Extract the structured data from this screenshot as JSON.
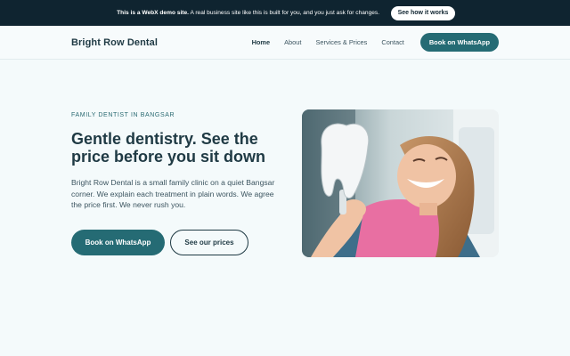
{
  "banner": {
    "bold": "This is a WebX demo site.",
    "text": " A real business site like this is built for you, and you just ask for changes.",
    "button": "See how it works"
  },
  "header": {
    "logo": "Bright Row Dental",
    "nav": [
      {
        "label": "Home",
        "active": true
      },
      {
        "label": "About"
      },
      {
        "label": "Services & Prices"
      },
      {
        "label": "Contact"
      }
    ],
    "cta": "Book on WhatsApp"
  },
  "hero": {
    "eyebrow": "FAMILY DENTIST IN BANGSAR",
    "title": "Gentle dentistry. See the price before you sit down",
    "lead": "Bright Row Dental is a small family clinic on a quiet Bangsar corner. We explain each treatment in plain words. We agree the price first. We never rush you.",
    "primary_button": "Book on WhatsApp",
    "secondary_button": "See our prices",
    "image": "smiling-patient-with-mirror-photo"
  },
  "colors": {
    "banner_bg": "#0f2430",
    "accent": "#256b74",
    "text": "#1f3a44",
    "page_bg": "#f4fafb"
  }
}
